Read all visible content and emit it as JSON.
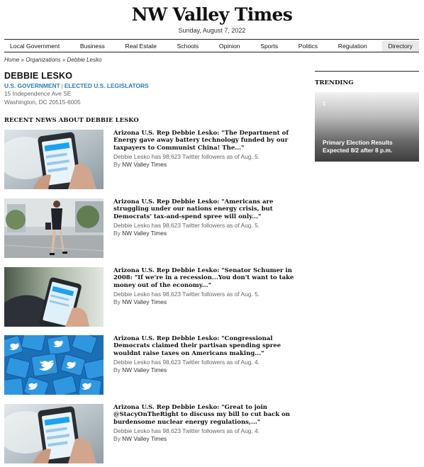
{
  "site": {
    "title": "NW Valley Times",
    "date": "Sunday, August 7, 2022"
  },
  "nav": {
    "items": [
      "Local Government",
      "Business",
      "Real Estate",
      "Schools",
      "Opinion",
      "Sports",
      "Politics",
      "Regulation",
      "Directory"
    ]
  },
  "breadcrumb": {
    "home": "Home",
    "sep1": " » ",
    "organizations": "Organizations",
    "sep2": " » ",
    "current": "Debbie Lesko"
  },
  "person": {
    "name": "DEBBIE LESKO",
    "category1": "U.S. GOVERNMENT",
    "separator": "|",
    "category2": "ELECTED U.S. LEGISLATORS",
    "address_line1": "15 Independence Ave SE",
    "address_line2": "Washington, DC 20515-6005"
  },
  "recent_news": {
    "heading": "RECENT NEWS ABOUT DEBBIE LESKO",
    "by_label": "By",
    "articles": [
      {
        "headline": "Arizona U.S. Rep Debbie Lesko: \"The Department of Energy gave away battery technology funded by our taxpayers to Communist China! The...\"",
        "meta": "Debbie Lesko has 98,623 Twitter followers as of Aug. 5.",
        "publisher": "NW Valley Times",
        "thumb_icon": "phone-in-hand-image"
      },
      {
        "headline": "Arizona U.S. Rep Debbie Lesko: \"Americans are struggling under our nations energy crisis, but Democrats' tax-and-spend spree will only...\"",
        "meta": "Debbie Lesko has 98,623 Twitter followers as of Aug. 5.",
        "publisher": "NW Valley Times",
        "thumb_icon": "woman-walking-image"
      },
      {
        "headline": "Arizona U.S. Rep Debbie Lesko: \"Senator Schumer in 2008: \"If we're in a recession...You don't want to take money out of the economy...\"",
        "meta": "Debbie Lesko has 98,623 Twitter followers as of Aug. 5.",
        "publisher": "NW Valley Times",
        "thumb_icon": "phone-in-hand-image"
      },
      {
        "headline": "Arizona U.S. Rep Debbie Lesko: \"Congressional Democrats claimed their partisan spending spree wouldnt raise taxes on Americans making...\"",
        "meta": "Debbie Lesko has 98,623 Twitter followers as of Aug. 4.",
        "publisher": "NW Valley Times",
        "thumb_icon": "twitter-bird-tiles-image"
      },
      {
        "headline": "Arizona U.S. Rep Debbie Lesko: \"Great to join @StacyOnTheRight to discuss my bill to cut back on burdensome nuclear energy regulations,...\"",
        "meta": "Debbie Lesko has 98,623 Twitter followers as of Aug. 4.",
        "publisher": "NW Valley Times",
        "thumb_icon": "phone-in-hand-image"
      }
    ]
  },
  "sidebar": {
    "trending_title": "TRENDING",
    "card": {
      "number": "1",
      "text": "Primary Election Results Expected 8/2 after 8 p.m."
    }
  },
  "colors": {
    "link_blue": "#2e7db6",
    "twitter_blue": "#1da1f2"
  }
}
